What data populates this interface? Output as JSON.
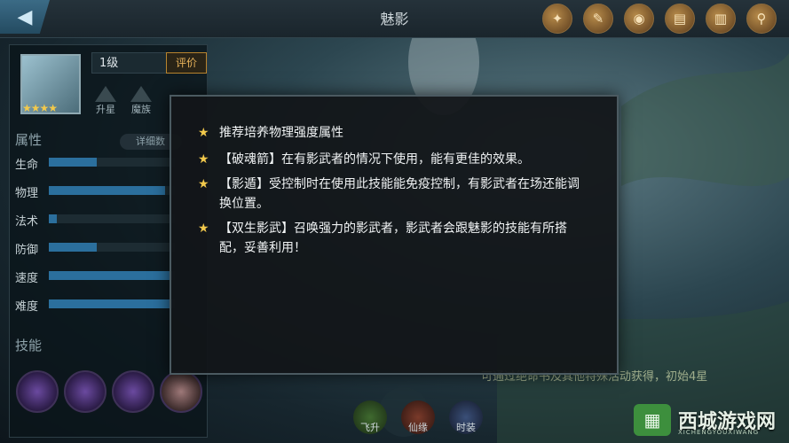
{
  "header": {
    "title": "魅影",
    "icons": [
      "scroll-seal-icon",
      "paper-scroll-icon",
      "round-seal-icon",
      "note-paper-icon",
      "book-icon",
      "magnifier-icon"
    ]
  },
  "hero": {
    "level": "1级",
    "rate_label": "评价",
    "stars": "★★★★",
    "actions": [
      "升星",
      "魔族"
    ]
  },
  "attributes": {
    "title": "属性",
    "detail_label": "详细数",
    "stats": [
      {
        "name": "生命",
        "value": 0.38
      },
      {
        "name": "物理",
        "value": 0.92
      },
      {
        "name": "法术",
        "value": 0.06
      },
      {
        "name": "防御",
        "value": 0.38
      },
      {
        "name": "速度",
        "value": 0.98
      },
      {
        "name": "难度",
        "value": 0.98
      }
    ]
  },
  "skills": {
    "title": "技能"
  },
  "bottom": {
    "note": "可通过绝命书及其他特殊活动获得，初始4星",
    "buttons": [
      "飞升",
      "仙缘",
      "时装"
    ]
  },
  "watermark": {
    "name": "西城游戏网",
    "sub": "XICHENGYOUXIWANG"
  },
  "tips": [
    "推荐培养物理强度属性",
    "【破魂箭】在有影武者的情况下使用，能有更佳的效果。",
    "【影遁】受控制时在使用此技能能免疫控制，有影武者在场还能调换位置。",
    "【双生影武】召唤强力的影武者，影武者会跟魅影的技能有所搭配，妥善利用！"
  ],
  "colors": {
    "accent": "#f2c94c",
    "bar": "#2b6f9d"
  }
}
